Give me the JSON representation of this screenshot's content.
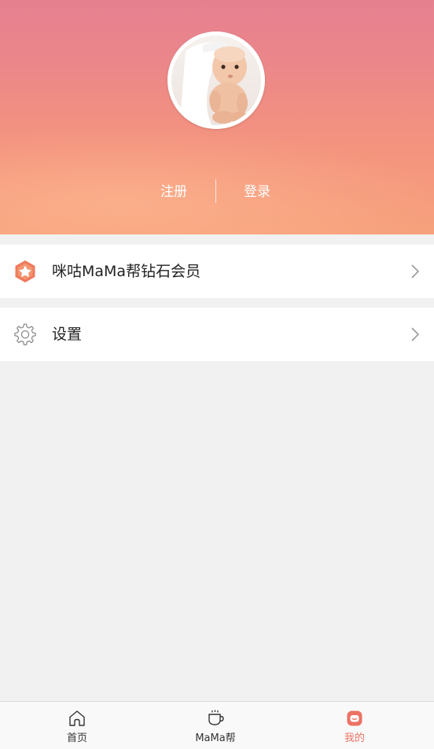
{
  "header": {
    "register_label": "注册",
    "login_label": "登录"
  },
  "menu": {
    "vip": {
      "label": "咪咕MaMa帮钻石会员",
      "icon": "diamond-member-icon"
    },
    "settings": {
      "label": "设置",
      "icon": "gear-icon"
    }
  },
  "tabbar": {
    "tabs": [
      {
        "label": "首页",
        "icon": "home-icon",
        "active": false
      },
      {
        "label": "MaMa帮",
        "icon": "cup-icon",
        "active": false
      },
      {
        "label": "我的",
        "icon": "profile-icon",
        "active": true
      }
    ]
  },
  "colors": {
    "accent": "#ec7263",
    "header_top": "#e98590",
    "header_bottom": "#f7a17c",
    "background": "#f1f1f1"
  }
}
